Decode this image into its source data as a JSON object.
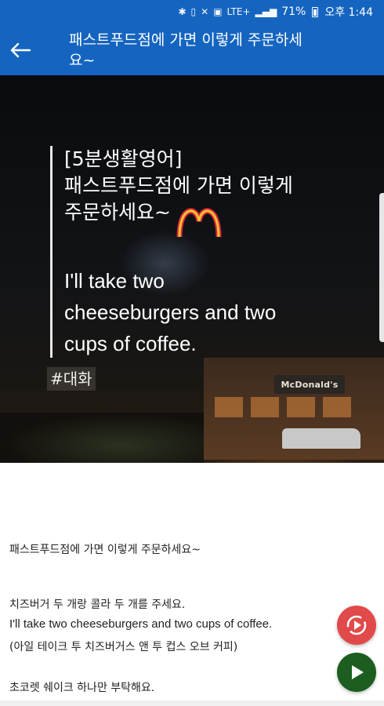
{
  "status_bar": {
    "icons": [
      "bluetooth-icon",
      "vibrate-icon",
      "mute-icon",
      "hd-icon",
      "lte-icon",
      "signal-icon",
      "battery-icon"
    ],
    "lte": "LTE+",
    "battery": "71%",
    "time": "오후 1:44"
  },
  "app_bar": {
    "title": "패스트푸드점에 가면 이렇게 주문하세요~",
    "color": "#1565c0"
  },
  "hero": {
    "headline_1": "[5분생활영어]",
    "headline_2": "패스트푸드점에 가면 이렇게",
    "headline_3": "주문하세요~",
    "english_1": "I'll take two",
    "english_2": "cheeseburgers and two",
    "english_3": "cups of coffee.",
    "tag": "#대화",
    "sign_text": "McDonald's"
  },
  "content": {
    "title": "패스트푸드점에 가면 이렇게 주문하세요~",
    "korean_1": "치즈버거 두 개랑 콜라 두 개를 주세요.",
    "english_1": "I'll take two cheeseburgers and two cups of coffee.",
    "pronunciation_1": "(아일 테이크 투 치즈버거스 앤 투 컵스 오브 커피)",
    "korean_2": "초코렛 쉐이크 하나만 부탁해요."
  },
  "buttons": {
    "repeat_color": "#e14a4a",
    "play_color": "#1b5e20"
  }
}
